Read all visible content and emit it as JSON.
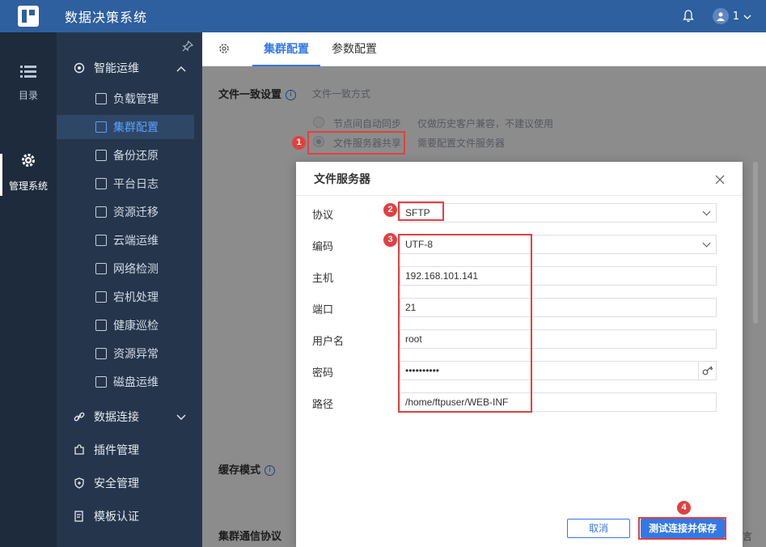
{
  "app": {
    "title": "数据决策系统",
    "user_label": "1"
  },
  "rail": [
    {
      "label": "目录",
      "icon": "list-icon"
    },
    {
      "label": "管理系统",
      "icon": "gear-icon"
    }
  ],
  "sidebar": {
    "groups": [
      {
        "label": "智能运维",
        "expanded": true
      },
      {
        "label": "数据连接",
        "expanded": false
      },
      {
        "label": "插件管理"
      },
      {
        "label": "安全管理"
      },
      {
        "label": "模板认证"
      }
    ],
    "items": [
      {
        "label": "负载管理"
      },
      {
        "label": "集群配置",
        "active": true
      },
      {
        "label": "备份还原"
      },
      {
        "label": "平台日志"
      },
      {
        "label": "资源迁移"
      },
      {
        "label": "云端运维"
      },
      {
        "label": "网络检测"
      },
      {
        "label": "宕机处理"
      },
      {
        "label": "健康巡检"
      },
      {
        "label": "资源异常"
      },
      {
        "label": "磁盘运维"
      }
    ]
  },
  "tabs": {
    "cluster": "集群配置",
    "params": "参数配置"
  },
  "settings": {
    "file_consistency_label": "文件一致设置",
    "file_consistency_mode": "文件一致方式",
    "option1_label": "节点间自动同步",
    "option1_hint": "仅做历史客户兼容，不建议使用",
    "option2_label": "文件服务器共享",
    "option2_hint": "需要配置文件服务器",
    "cache_mode_label": "缓存模式",
    "cluster_protocol_label": "集群通信协议",
    "cut_text": "言"
  },
  "dialog": {
    "title": "文件服务器",
    "fields": [
      {
        "label": "协议",
        "value": "SFTP"
      },
      {
        "label": "编码",
        "value": "UTF-8"
      },
      {
        "label": "主机",
        "value": "192.168.101.141"
      },
      {
        "label": "端口",
        "value": "21"
      },
      {
        "label": "用户名",
        "value": "root"
      },
      {
        "label": "密码",
        "value": "••••••••••"
      },
      {
        "label": "路径",
        "value": "/home/ftpuser/WEB-INF"
      }
    ],
    "cancel_label": "取消",
    "save_label": "测试连接并保存"
  },
  "annotations": [
    "1",
    "2",
    "3",
    "4"
  ],
  "colors": {
    "topbar": "#2e5f9e",
    "accent": "#3478e5",
    "annotation": "#e24040",
    "sidebar": "#25364c",
    "rail": "#1d2b3d"
  }
}
